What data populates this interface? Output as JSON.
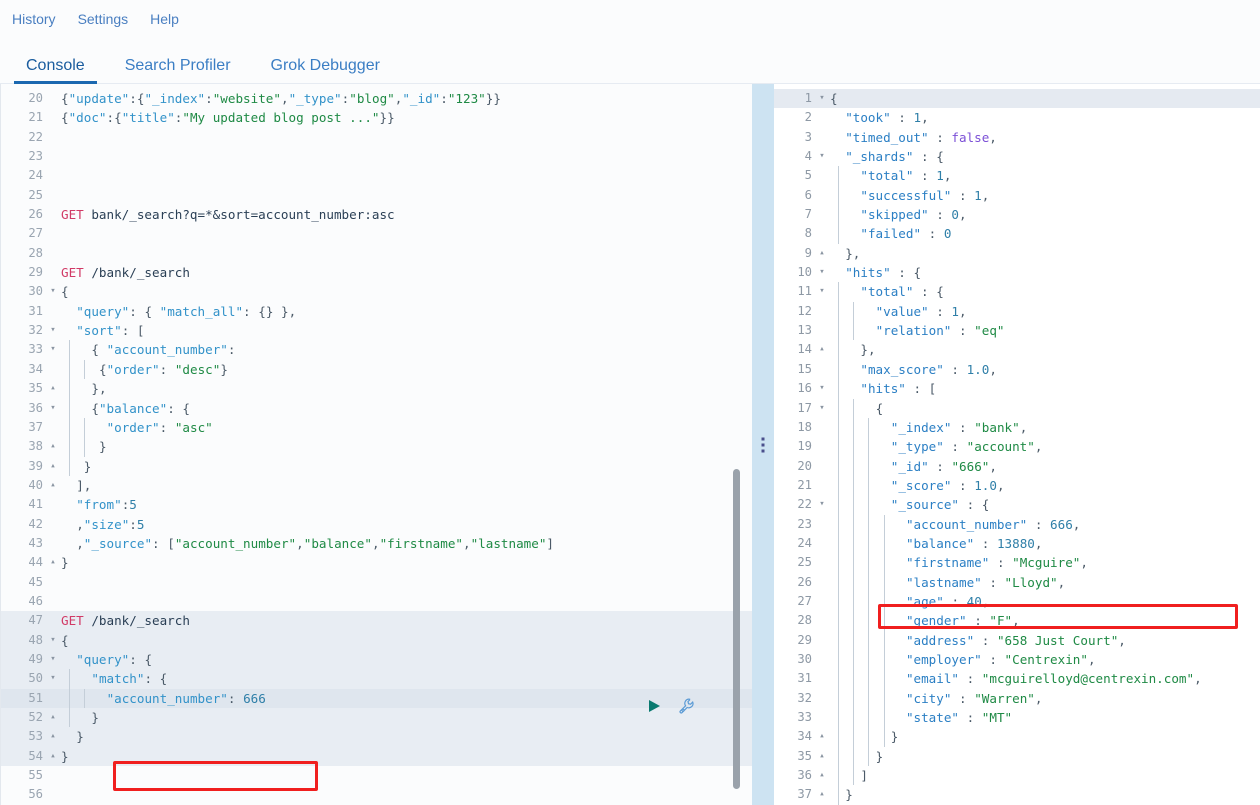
{
  "menubar": {
    "items": [
      {
        "label": "History",
        "name": "menu-item-history"
      },
      {
        "label": "Settings",
        "name": "menu-item-settings"
      },
      {
        "label": "Help",
        "name": "menu-item-help"
      }
    ]
  },
  "tabs": {
    "items": [
      {
        "label": "Console",
        "active": true
      },
      {
        "label": "Search Profiler",
        "active": false
      },
      {
        "label": "Grok Debugger",
        "active": false
      }
    ],
    "active_label": "Console",
    "active_indicator_color": "#1b68b0"
  },
  "colors": {
    "accent": "#1b68b0",
    "link": "#4a7fc1",
    "method": "#d13a66",
    "string": "#1f8a45",
    "key": "#2b7fc4",
    "number": "#2f7fa8",
    "boolean": "#7b4fd6",
    "annotation": "#f01f1f",
    "divider": "#cde3f2",
    "active_request_bg": "#e8edf3",
    "cursor_line_bg": "#dfe6ee"
  },
  "editor": {
    "name": "request-editor",
    "first_line_number": 20,
    "last_line_number": 56,
    "active_request_lines": [
      47,
      54
    ],
    "cursor_line": 51,
    "lines": [
      {
        "n": 20,
        "fold": "",
        "indent": 0,
        "text": "{\"update\":{\"_index\":\"website\",\"_type\":\"blog\",\"_id\":\"123\"}}"
      },
      {
        "n": 21,
        "fold": "",
        "indent": 0,
        "text": "{\"doc\":{\"title\":\"My updated blog post ...\"}}"
      },
      {
        "n": 22,
        "fold": "",
        "indent": 0,
        "text": ""
      },
      {
        "n": 23,
        "fold": "",
        "indent": 0,
        "text": ""
      },
      {
        "n": 24,
        "fold": "",
        "indent": 0,
        "text": ""
      },
      {
        "n": 25,
        "fold": "",
        "indent": 0,
        "text": ""
      },
      {
        "n": 26,
        "fold": "",
        "indent": 0,
        "text": "GET bank/_search?q=*&sort=account_number:asc"
      },
      {
        "n": 27,
        "fold": "",
        "indent": 0,
        "text": ""
      },
      {
        "n": 28,
        "fold": "",
        "indent": 0,
        "text": ""
      },
      {
        "n": 29,
        "fold": "",
        "indent": 0,
        "text": "GET /bank/_search"
      },
      {
        "n": 30,
        "fold": "▾",
        "indent": 0,
        "text": "{"
      },
      {
        "n": 31,
        "fold": "",
        "indent": 0,
        "text": "  \"query\": { \"match_all\": {} },"
      },
      {
        "n": 32,
        "fold": "▾",
        "indent": 0,
        "text": "  \"sort\": ["
      },
      {
        "n": 33,
        "fold": "▾",
        "indent": 1,
        "text": "    { \"account_number\":"
      },
      {
        "n": 34,
        "fold": "",
        "indent": 2,
        "text": "     {\"order\": \"desc\"}"
      },
      {
        "n": 35,
        "fold": "▴",
        "indent": 1,
        "text": "    },"
      },
      {
        "n": 36,
        "fold": "▾",
        "indent": 1,
        "text": "    {\"balance\": {"
      },
      {
        "n": 37,
        "fold": "",
        "indent": 2,
        "text": "      \"order\": \"asc\""
      },
      {
        "n": 38,
        "fold": "▴",
        "indent": 2,
        "text": "     }"
      },
      {
        "n": 39,
        "fold": "▴",
        "indent": 1,
        "text": "   }"
      },
      {
        "n": 40,
        "fold": "▴",
        "indent": 0,
        "text": "  ],"
      },
      {
        "n": 41,
        "fold": "",
        "indent": 0,
        "text": "  \"from\":5"
      },
      {
        "n": 42,
        "fold": "",
        "indent": 0,
        "text": "  ,\"size\":5"
      },
      {
        "n": 43,
        "fold": "",
        "indent": 0,
        "text": "  ,\"_source\": [\"account_number\",\"balance\",\"firstname\",\"lastname\"]"
      },
      {
        "n": 44,
        "fold": "▴",
        "indent": 0,
        "text": "}"
      },
      {
        "n": 45,
        "fold": "",
        "indent": 0,
        "text": ""
      },
      {
        "n": 46,
        "fold": "",
        "indent": 0,
        "text": ""
      },
      {
        "n": 47,
        "fold": "",
        "indent": 0,
        "text": "GET /bank/_search"
      },
      {
        "n": 48,
        "fold": "▾",
        "indent": 0,
        "text": "{"
      },
      {
        "n": 49,
        "fold": "▾",
        "indent": 0,
        "text": "  \"query\": {"
      },
      {
        "n": 50,
        "fold": "▾",
        "indent": 1,
        "text": "    \"match\": {"
      },
      {
        "n": 51,
        "fold": "",
        "indent": 2,
        "text": "      \"account_number\": 666"
      },
      {
        "n": 52,
        "fold": "▴",
        "indent": 1,
        "text": "    }"
      },
      {
        "n": 53,
        "fold": "▴",
        "indent": 0,
        "text": "  }"
      },
      {
        "n": 54,
        "fold": "▴",
        "indent": 0,
        "text": "}"
      },
      {
        "n": 55,
        "fold": "",
        "indent": 0,
        "text": ""
      },
      {
        "n": 56,
        "fold": "",
        "indent": 0,
        "text": ""
      }
    ],
    "actions": {
      "play_button_name": "send-request-play-button",
      "wrench_button_name": "request-options-wrench-icon"
    }
  },
  "response": {
    "name": "response-viewer",
    "first_line_number": 1,
    "last_line_number": 37,
    "highlight_line": 1,
    "lines": [
      {
        "n": 1,
        "fold": "▾",
        "indent": 0,
        "text": "{"
      },
      {
        "n": 2,
        "fold": "",
        "indent": 0,
        "text": "  \"took\" : 1,"
      },
      {
        "n": 3,
        "fold": "",
        "indent": 0,
        "text": "  \"timed_out\" : false,"
      },
      {
        "n": 4,
        "fold": "▾",
        "indent": 0,
        "text": "  \"_shards\" : {"
      },
      {
        "n": 5,
        "fold": "",
        "indent": 1,
        "text": "    \"total\" : 1,"
      },
      {
        "n": 6,
        "fold": "",
        "indent": 1,
        "text": "    \"successful\" : 1,"
      },
      {
        "n": 7,
        "fold": "",
        "indent": 1,
        "text": "    \"skipped\" : 0,"
      },
      {
        "n": 8,
        "fold": "",
        "indent": 1,
        "text": "    \"failed\" : 0"
      },
      {
        "n": 9,
        "fold": "▴",
        "indent": 0,
        "text": "  },"
      },
      {
        "n": 10,
        "fold": "▾",
        "indent": 0,
        "text": "  \"hits\" : {"
      },
      {
        "n": 11,
        "fold": "▾",
        "indent": 1,
        "text": "    \"total\" : {"
      },
      {
        "n": 12,
        "fold": "",
        "indent": 2,
        "text": "      \"value\" : 1,"
      },
      {
        "n": 13,
        "fold": "",
        "indent": 2,
        "text": "      \"relation\" : \"eq\""
      },
      {
        "n": 14,
        "fold": "▴",
        "indent": 1,
        "text": "    },"
      },
      {
        "n": 15,
        "fold": "",
        "indent": 1,
        "text": "    \"max_score\" : 1.0,"
      },
      {
        "n": 16,
        "fold": "▾",
        "indent": 1,
        "text": "    \"hits\" : ["
      },
      {
        "n": 17,
        "fold": "▾",
        "indent": 2,
        "text": "      {"
      },
      {
        "n": 18,
        "fold": "",
        "indent": 3,
        "text": "        \"_index\" : \"bank\","
      },
      {
        "n": 19,
        "fold": "",
        "indent": 3,
        "text": "        \"_type\" : \"account\","
      },
      {
        "n": 20,
        "fold": "",
        "indent": 3,
        "text": "        \"_id\" : \"666\","
      },
      {
        "n": 21,
        "fold": "",
        "indent": 3,
        "text": "        \"_score\" : 1.0,"
      },
      {
        "n": 22,
        "fold": "▾",
        "indent": 3,
        "text": "        \"_source\" : {"
      },
      {
        "n": 23,
        "fold": "",
        "indent": 4,
        "text": "          \"account_number\" : 666,"
      },
      {
        "n": 24,
        "fold": "",
        "indent": 4,
        "text": "          \"balance\" : 13880,"
      },
      {
        "n": 25,
        "fold": "",
        "indent": 4,
        "text": "          \"firstname\" : \"Mcguire\","
      },
      {
        "n": 26,
        "fold": "",
        "indent": 4,
        "text": "          \"lastname\" : \"Lloyd\","
      },
      {
        "n": 27,
        "fold": "",
        "indent": 4,
        "text": "          \"age\" : 40,"
      },
      {
        "n": 28,
        "fold": "",
        "indent": 4,
        "text": "          \"gender\" : \"F\","
      },
      {
        "n": 29,
        "fold": "",
        "indent": 4,
        "text": "          \"address\" : \"658 Just Court\","
      },
      {
        "n": 30,
        "fold": "",
        "indent": 4,
        "text": "          \"employer\" : \"Centrexin\","
      },
      {
        "n": 31,
        "fold": "",
        "indent": 4,
        "text": "          \"email\" : \"mcguirelloyd@centrexin.com\","
      },
      {
        "n": 32,
        "fold": "",
        "indent": 4,
        "text": "          \"city\" : \"Warren\","
      },
      {
        "n": 33,
        "fold": "",
        "indent": 4,
        "text": "          \"state\" : \"MT\""
      },
      {
        "n": 34,
        "fold": "▴",
        "indent": 4,
        "text": "        }"
      },
      {
        "n": 35,
        "fold": "▴",
        "indent": 3,
        "text": "      }"
      },
      {
        "n": 36,
        "fold": "▴",
        "indent": 2,
        "text": "    ]"
      },
      {
        "n": 37,
        "fold": "▴",
        "indent": 1,
        "text": "  }"
      }
    ]
  },
  "annotations": [
    {
      "name": "annotation-box-request-account-number",
      "target_line": 51,
      "pane": "request",
      "color": "#f01f1f"
    },
    {
      "name": "annotation-box-response-account-number",
      "target_line": 23,
      "pane": "response",
      "color": "#f01f1f"
    }
  ],
  "divider": {
    "name": "pane-resize-handle",
    "glyph": "⋮"
  }
}
